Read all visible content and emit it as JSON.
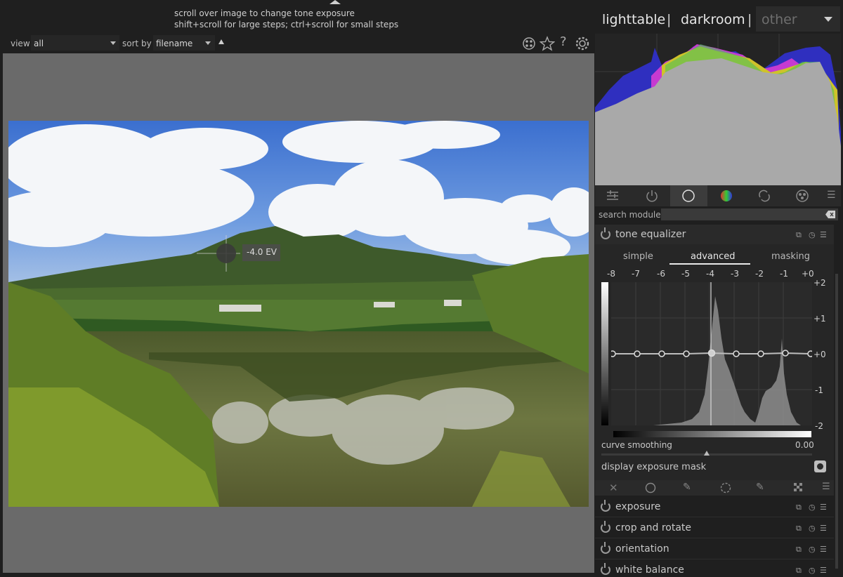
{
  "tooltip": {
    "line1": "scroll over image to change tone exposure",
    "line2": "shift+scroll for large steps; ctrl+scroll for small steps"
  },
  "view_bar": {
    "view_label": "view",
    "view_value": "all",
    "sort_label": "sort by",
    "sort_value": "filename"
  },
  "views": {
    "lighttable": "lighttable",
    "darkroom": "darkroom",
    "other": "other",
    "sep": "|"
  },
  "cursor_overlay": {
    "ev": "-4.0 EV"
  },
  "search": {
    "label": "search module"
  },
  "tone_equalizer": {
    "title": "tone equalizer",
    "tabs": [
      "simple",
      "advanced",
      "masking"
    ],
    "active_tab": "advanced",
    "x_ticks": [
      "-8",
      "-7",
      "-6",
      "-5",
      "-4",
      "-3",
      "-2",
      "-1",
      "+0"
    ],
    "y_ticks": [
      "+2",
      "+1",
      "+0",
      "-1",
      "-2"
    ],
    "curve_smoothing_label": "curve smoothing",
    "curve_smoothing_value": "0.00",
    "display_mask_label": "display exposure mask"
  },
  "modules": [
    "exposure",
    "crop and rotate",
    "orientation",
    "white balance"
  ],
  "colors": {
    "accent": "#e9e9e9",
    "panel": "#262626",
    "background": "#1f1f1f"
  }
}
